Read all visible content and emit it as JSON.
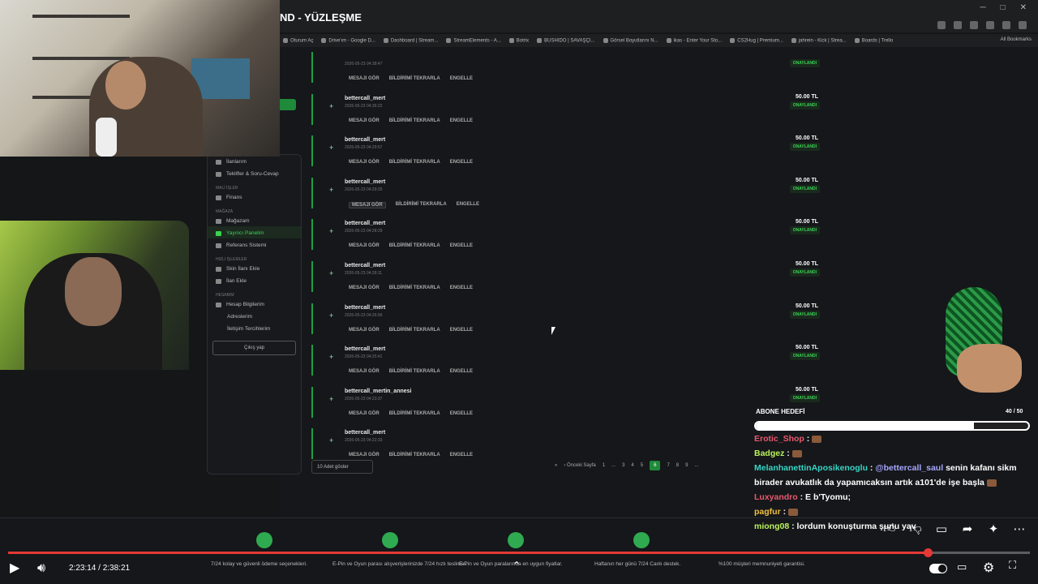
{
  "browser": {
    "tab_title": "ND - YÜZLEŞME",
    "bookmarks": [
      "Oturum Aç",
      "Drive'ım - Google D...",
      "Dashboard | Stream...",
      "StreamElements - A...",
      "Botrix",
      "BUSHIDO | SAVAŞÇI...",
      "Görsel Boyutlarını N...",
      "ikas - Enter Your Sto...",
      "CS2Hug | Premium...",
      "jahrein - Kick | Strea...",
      "Boards | Trello"
    ],
    "all_bookmarks": "All Bookmarks"
  },
  "sidebar": {
    "items": [
      {
        "label": "İlanlarım",
        "section": ""
      },
      {
        "label": "Teklifler & Soru-Cevap",
        "section": ""
      },
      {
        "label": "Finans",
        "section": "MALİ İŞLER"
      },
      {
        "label": "Mağazam",
        "section": "MAĞAZA"
      },
      {
        "label": "Yayıncı Panelim",
        "section": ""
      },
      {
        "label": "Referans Sistemi",
        "section": ""
      },
      {
        "label": "Skin İlanı Ekle",
        "section": "HIZLI İŞLEMLER"
      },
      {
        "label": "İlan Ekle",
        "section": ""
      },
      {
        "label": "Hesap Bilgilerim",
        "section": "HESABIM"
      },
      {
        "label": "Adreslerim",
        "section": ""
      },
      {
        "label": "İletişim Tercihlerim",
        "section": ""
      }
    ],
    "logout": "Çıkış yap"
  },
  "donations": [
    {
      "user": "",
      "date": "2026-05-23 04:38:47",
      "amount": "",
      "status": "ONAYLANDI"
    },
    {
      "user": "bettercall_mert",
      "date": "2026-05-23 04:36:22",
      "amount": "50.00 TL",
      "status": "ONAYLANDI"
    },
    {
      "user": "bettercall_mert",
      "date": "2026-05-23 04:29:57",
      "amount": "50.00 TL",
      "status": "ONAYLANDI"
    },
    {
      "user": "bettercall_mert",
      "date": "2026-05-23 04:29:25",
      "amount": "50.00 TL",
      "status": "ONAYLANDI"
    },
    {
      "user": "bettercall_mert",
      "date": "2026-05-23 04:28:29",
      "amount": "50.00 TL",
      "status": "ONAYLANDI"
    },
    {
      "user": "bettercall_mert",
      "date": "2026-05-23 04:28:11",
      "amount": "50.00 TL",
      "status": "ONAYLANDI"
    },
    {
      "user": "bettercall_mert",
      "date": "2026-05-23 04:26:56",
      "amount": "50.00 TL",
      "status": "ONAYLANDI"
    },
    {
      "user": "bettercall_mert",
      "date": "2026-05-23 04:25:41",
      "amount": "50.00 TL",
      "status": "ONAYLANDI"
    },
    {
      "user": "bettercall_mertin_annesi",
      "date": "2026-05-23 04:23:37",
      "amount": "50.00 TL",
      "status": "ONAYLANDI"
    },
    {
      "user": "bettercall_mert",
      "date": "2026-05-23 04:22:33",
      "amount": "",
      "status": ""
    }
  ],
  "row_actions": {
    "view": "MESAJI GÖR",
    "repeat": "BİLDİRİMİ TEKRARLA",
    "block": "ENGELLE"
  },
  "pagination": {
    "page_size": "10 Adet göster",
    "first": "«",
    "prev": "‹ Önceki Sayfa",
    "pages": [
      "1",
      "...",
      "3",
      "4",
      "5",
      "6",
      "7",
      "8",
      "9",
      "..."
    ],
    "current": "6"
  },
  "footer_features": [
    "7/24 kolay ve güvenli ödeme seçenekleri.",
    "E-Pin ve Oyun parası alışverişlerinizde 7/24 hızlı teslimat.",
    "E-Pin ve Oyun paralarında en uygun fiyatlar.",
    "Haftanın her günü 7/24 Canlı destek.",
    "%100 müşteri memnuniyeti garantisi."
  ],
  "overlay": {
    "goal_label": "ABONE HEDEFİ",
    "goal_count": "40 / 50",
    "goal_fraction": 0.8
  },
  "chat": [
    {
      "user": "Erotic_Shop",
      "text": ""
    },
    {
      "user": "Badgez",
      "text": ""
    },
    {
      "user": "MelanhanettinAposikenoglu",
      "mention": "@bettercall_saul",
      "text": "senin kafanı sikm birader avukatlık da yapamıcaksın artık a101'de işe başla"
    },
    {
      "user": "Luxyandro",
      "text": "E b'Tyomu;"
    },
    {
      "user": "pagfur",
      "text": ""
    },
    {
      "user": "miong08",
      "text": "lordum konuşturma şunu yav"
    }
  ],
  "player": {
    "time": "2:23:14 / 2:38:21",
    "progress": 0.9
  },
  "colors": {
    "accent_green": "#39d353",
    "progress_red": "#e53935"
  }
}
